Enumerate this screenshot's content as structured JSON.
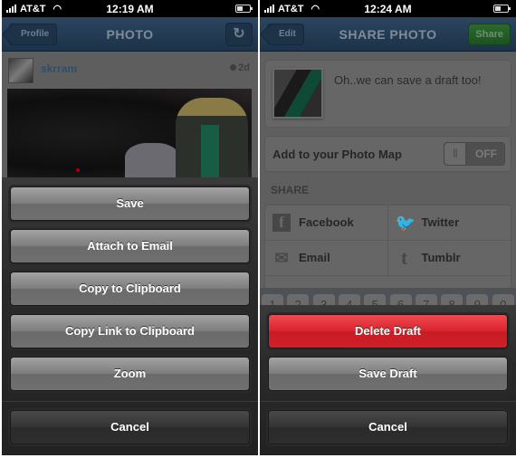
{
  "left_screen": {
    "status_bar": {
      "carrier": "AT&T",
      "time": "12:19 AM"
    },
    "nav": {
      "back_label": "Profile",
      "title": "PHOTO",
      "refresh_icon": "refresh-icon"
    },
    "post": {
      "username": "skrram",
      "age": "2d"
    },
    "action_sheet": {
      "buttons": [
        "Save",
        "Attach to Email",
        "Copy to Clipboard",
        "Copy Link to Clipboard",
        "Zoom"
      ],
      "cancel_label": "Cancel"
    }
  },
  "right_screen": {
    "status_bar": {
      "carrier": "AT&T",
      "time": "12:24 AM"
    },
    "nav": {
      "back_label": "Edit",
      "title": "SHARE PHOTO",
      "share_label": "Share"
    },
    "caption": "Oh..we can save a draft too!",
    "photo_map": {
      "label": "Add to your Photo Map",
      "toggle_state": "OFF"
    },
    "share": {
      "heading": "SHARE",
      "services": [
        {
          "label": "Facebook",
          "icon": "f"
        },
        {
          "label": "Twitter",
          "icon": "🐦"
        },
        {
          "label": "Email",
          "icon": "✉"
        },
        {
          "label": "Tumblr",
          "icon": "t"
        }
      ]
    },
    "keyboard_keys": [
      "1",
      "2",
      "3",
      "4",
      "5",
      "6",
      "7",
      "8",
      "9",
      "0"
    ],
    "action_sheet": {
      "delete_label": "Delete Draft",
      "save_label": "Save Draft",
      "cancel_label": "Cancel"
    }
  }
}
